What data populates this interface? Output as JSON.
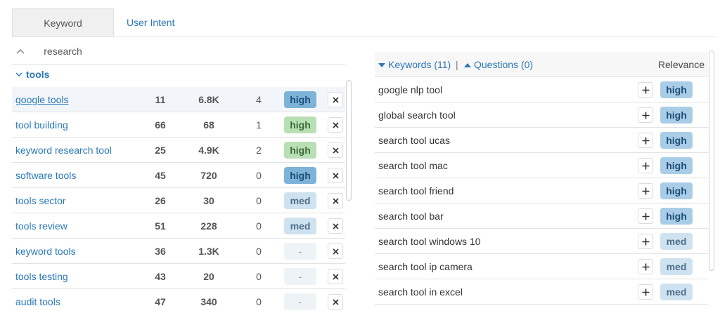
{
  "tabs": [
    {
      "label": "Keyword research",
      "active": true
    },
    {
      "label": "User Intent",
      "active": false
    }
  ],
  "group": {
    "name": "tools"
  },
  "keyword_rows": [
    {
      "keyword": "google tools",
      "col1": "11",
      "col2": "6.8K",
      "col3": "4",
      "relevance": "high",
      "style": "b-high-blue",
      "selected": true
    },
    {
      "keyword": "tool building",
      "col1": "66",
      "col2": "68",
      "col3": "1",
      "relevance": "high",
      "style": "b-high-green"
    },
    {
      "keyword": "keyword research tool",
      "col1": "25",
      "col2": "4.9K",
      "col3": "2",
      "relevance": "high",
      "style": "b-high-green"
    },
    {
      "keyword": "software tools",
      "col1": "45",
      "col2": "720",
      "col3": "0",
      "relevance": "high",
      "style": "b-high-blue"
    },
    {
      "keyword": "tools sector",
      "col1": "26",
      "col2": "30",
      "col3": "0",
      "relevance": "med",
      "style": "b-med"
    },
    {
      "keyword": "tools review",
      "col1": "51",
      "col2": "228",
      "col3": "0",
      "relevance": "med",
      "style": "b-med"
    },
    {
      "keyword": "keyword tools",
      "col1": "36",
      "col2": "1.3K",
      "col3": "0",
      "relevance": "-",
      "style": "b-dash"
    },
    {
      "keyword": "tools testing",
      "col1": "43",
      "col2": "20",
      "col3": "0",
      "relevance": "-",
      "style": "b-dash"
    },
    {
      "keyword": "audit tools",
      "col1": "47",
      "col2": "340",
      "col3": "0",
      "relevance": "-",
      "style": "b-dash"
    }
  ],
  "right_panel": {
    "keywords_tab": "Keywords (11)",
    "separator": "|",
    "questions_tab": "Questions (0)",
    "relevance_header": "Relevance"
  },
  "suggestion_rows": [
    {
      "keyword": "google nlp tool",
      "relevance": "high"
    },
    {
      "keyword": "global search tool",
      "relevance": "high"
    },
    {
      "keyword": "search tool ucas",
      "relevance": "high"
    },
    {
      "keyword": "search tool mac",
      "relevance": "high"
    },
    {
      "keyword": "search tool friend",
      "relevance": "high"
    },
    {
      "keyword": "search tool bar",
      "relevance": "high"
    },
    {
      "keyword": "search tool windows 10",
      "relevance": "med"
    },
    {
      "keyword": "search tool ip camera",
      "relevance": "med"
    },
    {
      "keyword": "search tool in excel",
      "relevance": "med"
    }
  ],
  "colors": {
    "link": "#2a78b8",
    "high_blue": "#7eb3d8",
    "high_green": "#b8e0b4",
    "med": "#cfe2f0"
  },
  "icons": {
    "collapse": "chevron-up-icon",
    "group_toggle": "chevron-down-icon",
    "remove": "close-icon",
    "add": "plus-icon"
  }
}
